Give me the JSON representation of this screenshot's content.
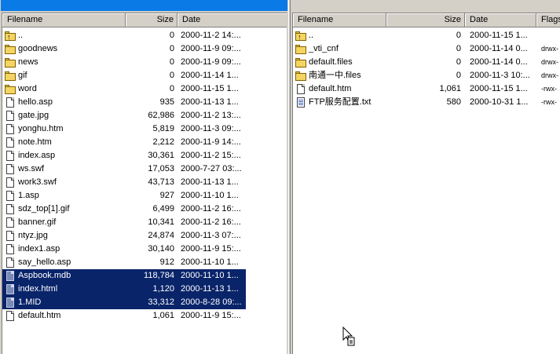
{
  "left": {
    "columns": {
      "filename": "Filename",
      "size": "Size",
      "date": "Date"
    },
    "rows": [
      {
        "name": "..",
        "size": "0",
        "date": "2000-11-2 14:...",
        "icon": "up-folder-icon",
        "selected": false
      },
      {
        "name": "goodnews",
        "size": "0",
        "date": "2000-11-9 09:...",
        "icon": "folder-icon",
        "selected": false
      },
      {
        "name": "news",
        "size": "0",
        "date": "2000-11-9 09:...",
        "icon": "folder-icon",
        "selected": false
      },
      {
        "name": "gif",
        "size": "0",
        "date": "2000-11-14 1...",
        "icon": "folder-icon",
        "selected": false
      },
      {
        "name": "word",
        "size": "0",
        "date": "2000-11-15 1...",
        "icon": "folder-icon",
        "selected": false
      },
      {
        "name": "hello.asp",
        "size": "935",
        "date": "2000-11-13 1...",
        "icon": "file-icon",
        "selected": false
      },
      {
        "name": "gate.jpg",
        "size": "62,986",
        "date": "2000-11-2 13:...",
        "icon": "file-icon",
        "selected": false
      },
      {
        "name": "yonghu.htm",
        "size": "5,819",
        "date": "2000-11-3 09:...",
        "icon": "file-icon",
        "selected": false
      },
      {
        "name": "note.htm",
        "size": "2,212",
        "date": "2000-11-9 14:...",
        "icon": "file-icon",
        "selected": false
      },
      {
        "name": "index.asp",
        "size": "30,361",
        "date": "2000-11-2 15:...",
        "icon": "file-icon",
        "selected": false
      },
      {
        "name": "ws.swf",
        "size": "17,053",
        "date": "2000-7-27 03:...",
        "icon": "file-icon",
        "selected": false
      },
      {
        "name": "work3.swf",
        "size": "43,713",
        "date": "2000-11-13 1...",
        "icon": "file-icon",
        "selected": false
      },
      {
        "name": "1.asp",
        "size": "927",
        "date": "2000-11-10 1...",
        "icon": "file-icon",
        "selected": false
      },
      {
        "name": "sdz_top[1].gif",
        "size": "6,499",
        "date": "2000-11-2 16:...",
        "icon": "file-icon",
        "selected": false
      },
      {
        "name": "banner.gif",
        "size": "10,341",
        "date": "2000-11-2 16:...",
        "icon": "file-icon",
        "selected": false
      },
      {
        "name": "ntyz.jpg",
        "size": "24,874",
        "date": "2000-11-3 07:...",
        "icon": "file-icon",
        "selected": false
      },
      {
        "name": "index1.asp",
        "size": "30,140",
        "date": "2000-11-9 15:...",
        "icon": "file-icon",
        "selected": false
      },
      {
        "name": "say_hello.asp",
        "size": "912",
        "date": "2000-11-10 1...",
        "icon": "file-icon",
        "selected": false
      },
      {
        "name": "Aspbook.mdb",
        "size": "118,784",
        "date": "2000-11-10 1...",
        "icon": "file-icon",
        "selected": true
      },
      {
        "name": "index.html",
        "size": "1,120",
        "date": "2000-11-13 1...",
        "icon": "file-icon",
        "selected": true
      },
      {
        "name": "1.MID",
        "size": "33,312",
        "date": "2000-8-28 09:...",
        "icon": "file-icon",
        "selected": true
      },
      {
        "name": "default.htm",
        "size": "1,061",
        "date": "2000-11-9 15:...",
        "icon": "file-icon",
        "selected": false
      }
    ]
  },
  "right": {
    "columns": {
      "filename": "Filename",
      "size": "Size",
      "date": "Date",
      "flags": "Flags"
    },
    "rows": [
      {
        "name": "..",
        "size": "0",
        "date": "2000-11-15 1...",
        "flags": "",
        "icon": "up-folder-icon"
      },
      {
        "name": "_vti_cnf",
        "size": "0",
        "date": "2000-11-14 0...",
        "flags": "drwx-",
        "icon": "folder-icon"
      },
      {
        "name": "default.files",
        "size": "0",
        "date": "2000-11-14 0...",
        "flags": "drwx-",
        "icon": "folder-icon"
      },
      {
        "name": "南通一中.files",
        "size": "0",
        "date": "2000-11-3 10:...",
        "flags": "drwx-",
        "icon": "folder-icon"
      },
      {
        "name": "default.htm",
        "size": "1,061",
        "date": "2000-11-15 1...",
        "flags": "-rwx-",
        "icon": "file-icon"
      },
      {
        "name": "FTP服务配置.txt",
        "size": "580",
        "date": "2000-10-31 1...",
        "flags": "-rwx-",
        "icon": "text-file-icon"
      }
    ]
  },
  "colors": {
    "selection": "#0a246a",
    "title_active": "#0a7ae6",
    "face": "#d4d0c8"
  }
}
